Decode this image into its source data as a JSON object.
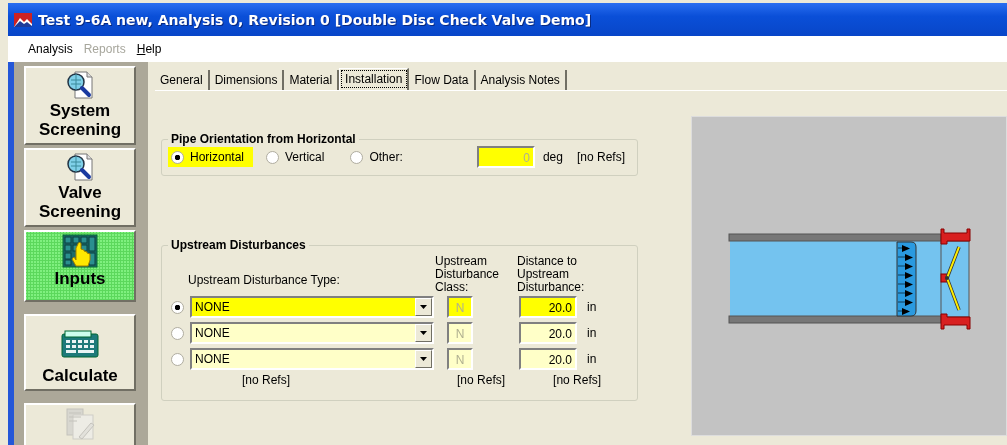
{
  "window": {
    "title": "Test 9-6A new, Analysis 0, Revision 0 [Double Disc Check Valve Demo]"
  },
  "menu": [
    {
      "label": "Analysis",
      "disabled": false,
      "mnemonic": false
    },
    {
      "label": "Reports",
      "disabled": true,
      "mnemonic": false
    },
    {
      "label": "Help",
      "disabled": false,
      "mnemonic": true
    }
  ],
  "sidebar": {
    "items": [
      {
        "kind": "magnifier",
        "label": "System Screening",
        "selected": false,
        "disabled": false
      },
      {
        "kind": "magnifier",
        "label": "Valve Screening",
        "selected": false,
        "disabled": false
      },
      {
        "kind": "keypad",
        "label": "Inputs",
        "selected": true,
        "disabled": false
      },
      {
        "kind": "calculator",
        "label": "Calculate",
        "selected": false,
        "disabled": false
      },
      {
        "kind": "report",
        "selected": false,
        "disabled": true
      }
    ]
  },
  "tabs": [
    {
      "label": "General",
      "selected": false
    },
    {
      "label": "Dimensions",
      "selected": false
    },
    {
      "label": "Material",
      "selected": false
    },
    {
      "label": "Installation",
      "selected": true
    },
    {
      "label": "Flow Data",
      "selected": false
    },
    {
      "label": "Analysis Notes",
      "selected": false
    }
  ],
  "orientation": {
    "title": "Pipe Orientation from Horizontal",
    "options": [
      {
        "label": "Horizontal",
        "selected": true
      },
      {
        "label": "Vertical",
        "selected": false
      },
      {
        "label": "Other:",
        "selected": false
      }
    ],
    "angle": {
      "value": "0",
      "disabled": true
    },
    "unit": "deg",
    "refs": "[no Refs]"
  },
  "upstream": {
    "title": "Upstream Disturbances",
    "headers": [
      "Upstream Disturbance Type:",
      "Upstream Disturbance Class:",
      "Distance to Upstream Disturbance:"
    ],
    "rows": [
      {
        "selected": true,
        "type": "NONE",
        "class": "N",
        "class_disabled": true,
        "distance": "20.0",
        "unit": "in"
      },
      {
        "selected": false,
        "type": "NONE",
        "class": "N",
        "class_disabled": true,
        "distance": "20.0",
        "unit": "in"
      },
      {
        "selected": false,
        "type": "NONE",
        "class": "N",
        "class_disabled": true,
        "distance": "20.0",
        "unit": "in"
      }
    ],
    "refs": [
      "[no Refs]",
      "[no Refs]",
      "[no Refs]"
    ]
  }
}
